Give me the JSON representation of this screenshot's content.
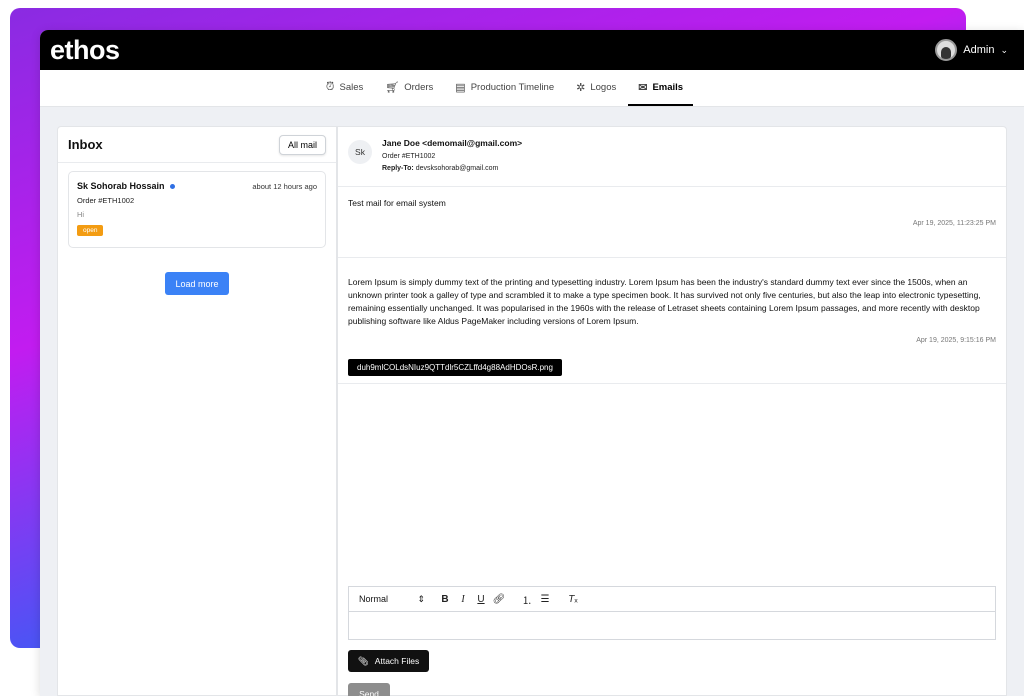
{
  "app": {
    "logo": "ethos"
  },
  "user": {
    "name": "Admin",
    "avatar_icon": "user-avatar"
  },
  "nav": {
    "items": [
      {
        "label": "Sales",
        "icon": "alarm-icon",
        "active": false
      },
      {
        "label": "Orders",
        "icon": "cart-icon",
        "active": false
      },
      {
        "label": "Production Timeline",
        "icon": "timeline-icon",
        "active": false
      },
      {
        "label": "Logos",
        "icon": "sparkle-icon",
        "active": false
      },
      {
        "label": "Emails",
        "icon": "mail-icon",
        "active": true
      }
    ]
  },
  "inbox": {
    "title": "Inbox",
    "filter_label": "All mail",
    "mails": [
      {
        "sender": "Sk Sohorab Hossain",
        "time": "about 12 hours ago",
        "order": "Order #ETH1002",
        "preview": "Hi",
        "status": "open"
      }
    ],
    "load_more_label": "Load more"
  },
  "thread": {
    "initials": "Sk",
    "from": "Jane Doe <demomail@gmail.com>",
    "order": "Order #ETH1002",
    "reply_to_label": "Reply-To:",
    "reply_to": "devsksohorab@gmail.com",
    "messages": [
      {
        "text": "Test mail for email system",
        "date": "Apr 19, 2025, 11:23:25 PM"
      },
      {
        "text": "Lorem Ipsum is simply dummy text of the printing and typesetting industry. Lorem Ipsum has been the industry's standard dummy text ever since the 1500s, when an unknown printer took a galley of type and scrambled it to make a type specimen book. It has survived not only five centuries, but also the leap into electronic typesetting, remaining essentially unchanged. It was popularised in the 1960s with the release of Letraset sheets containing Lorem Ipsum passages, and more recently with desktop publishing software like Aldus PageMaker including versions of Lorem Ipsum.",
        "date": "Apr 19, 2025, 9:15:16 PM",
        "attachment": "duh9mlCOLdsNIuz9QTTdlr5CZLffd4g88AdHDOsR.png"
      }
    ]
  },
  "composer": {
    "format_select": "Normal",
    "attach_label": "Attach Files",
    "send_label": "Send"
  },
  "colors": {
    "accent": "#3b82f6",
    "status_open": "#f39c12",
    "unread_dot": "#2f6fe4"
  }
}
